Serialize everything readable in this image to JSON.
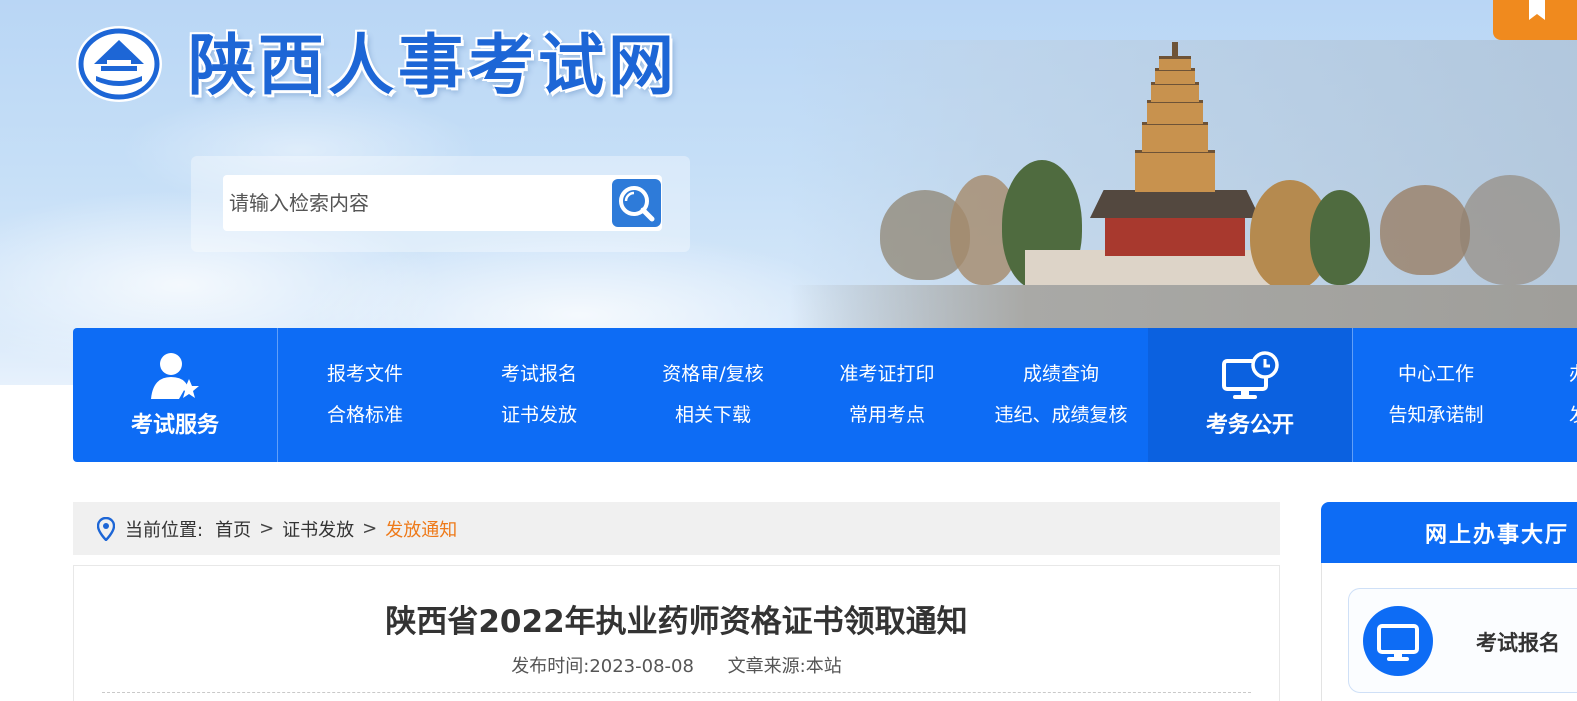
{
  "header": {
    "site_title": "陕西人事考试网",
    "search_placeholder": "请输入检索内容",
    "logo_icon": "pavilion-logo-icon",
    "search_icon": "magnifier-icon",
    "bookmark_icon": "bookmark-icon"
  },
  "nav": {
    "exam_services": {
      "label": "考试服务",
      "icon": "user-star-icon",
      "links": [
        "报考文件",
        "考试报名",
        "资格审/复核",
        "准考证打印",
        "成绩查询",
        "合格标准",
        "证书发放",
        "相关下载",
        "常用考点",
        "违纪、成绩复核"
      ]
    },
    "exam_affairs": {
      "label": "考务公开",
      "icon": "monitor-clock-icon",
      "links": [
        "中心工作",
        "告知承诺制",
        "办",
        "发"
      ]
    }
  },
  "breadcrumb": {
    "prefix": "当前位置:",
    "separator": ">",
    "items": [
      "首页",
      "证书发放"
    ],
    "current": "发放通知"
  },
  "article": {
    "title": "陕西省2022年执业药师资格证书领取通知",
    "publish_label": "发布时间:2023-08-08",
    "source_label": "文章来源:本站"
  },
  "sidebar": {
    "title": "网上办事大厅",
    "cards": [
      {
        "label": "考试报名",
        "icon": "monitor-icon"
      }
    ]
  },
  "colors": {
    "brand_blue": "#0d6cf5",
    "title_blue": "#1d66d6",
    "accent_orange": "#ee7a1a",
    "bookmark_orange": "#f08a1e"
  }
}
